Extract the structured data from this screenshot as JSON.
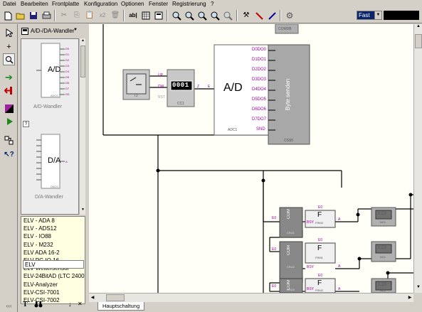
{
  "menubar": {
    "items": [
      "Datei",
      "Bearbeiten",
      "Frontplatte",
      "Konfiguration",
      "Optionen",
      "Fenster",
      "Registrierung",
      "?"
    ]
  },
  "toolbar": {
    "buttons": [
      "new-icon",
      "open-icon",
      "save-icon",
      "print-icon",
      "cut-icon",
      "copy-icon",
      "paste-icon",
      "duplicate-icon",
      "delete-icon",
      "text-icon",
      "grid-icon",
      "frontpanel-icon",
      "zoom-in-icon",
      "zoom-out-icon",
      "zoom-fit-icon",
      "zoom-all-icon",
      "zoom-page-icon",
      "tools-icon",
      "probe-icon",
      "wire-color-icon",
      "settings-icon"
    ],
    "duplicate_label": "x2",
    "text_label": "ab|",
    "speed_value": "Fast"
  },
  "library": {
    "category": "A/D-/DA-Wandler",
    "preview_items": [
      {
        "symbol": "A/D",
        "caption": "A/D-Wandler",
        "ref": "ADC0"
      },
      {
        "symbol": "D/A",
        "caption": "D/A-Wandler",
        "ref": "DAC0"
      }
    ],
    "help_badge": "?",
    "list": [
      "ELV - ADA 8",
      "ELV - ADS12",
      "ELV - IO88",
      "ELV - M232",
      "ELV ADA 16-2",
      "ELV PC-IO 16",
      "ELV Wettersensor",
      "ELV-24BitAD (LTC 2400)",
      "ELV-Analyzer",
      "ELV-CSI-7001",
      "ELV-CSI-7002"
    ],
    "search_value": "ELV",
    "footer": {
      "left": "‹‹‹",
      "text_tool": "T",
      "binoculars": "🔭",
      "pin": "↓",
      "close": "✕"
    }
  },
  "canvas": {
    "comdev_top_label": "COMDB",
    "switch_label": "T2",
    "counter_display": "0001",
    "counter_label": "CC1",
    "counter_pins": [
      "UP",
      "DW",
      "RST"
    ],
    "counter_out": "Z",
    "adc_in": "E",
    "adc_symbol": "A/D",
    "adc_label": "ADC1",
    "adc_outputs": [
      "D0DO0",
      "D1DO1",
      "D2DO2",
      "D3DO3",
      "D4DO4",
      "D5DO5",
      "D6DO6",
      "D7DO7",
      "SND"
    ],
    "sender_text": "Byte senden",
    "sender_label": "CSS5",
    "com_blocks": [
      {
        "label": "COM",
        "ref": "CRU1",
        "in": "E0",
        "bsy": "BSY"
      },
      {
        "label": "COM",
        "ref": "CRU2",
        "in": "E0",
        "bsy": "BSY"
      },
      {
        "label": "COM",
        "ref": "CRU3",
        "in": "E0",
        "bsy": "BSY"
      }
    ],
    "frm_blocks": [
      {
        "label": "F",
        "ref": "FRM3",
        "in": "E0",
        "out": "A"
      },
      {
        "label": "F",
        "ref": "FRM1",
        "in": "E0",
        "out": "A"
      },
      {
        "label": "F",
        "ref": "FRM2",
        "in": "E0",
        "out": "A"
      }
    ],
    "display_blocks": [
      {
        "value": "1.23",
        "ref": "NC1"
      },
      {
        "value": "1.23",
        "ref": "NC1"
      },
      {
        "value": "1.23",
        "ref": "NC2"
      }
    ]
  },
  "tabs": {
    "main": "Hauptschaltung"
  }
}
